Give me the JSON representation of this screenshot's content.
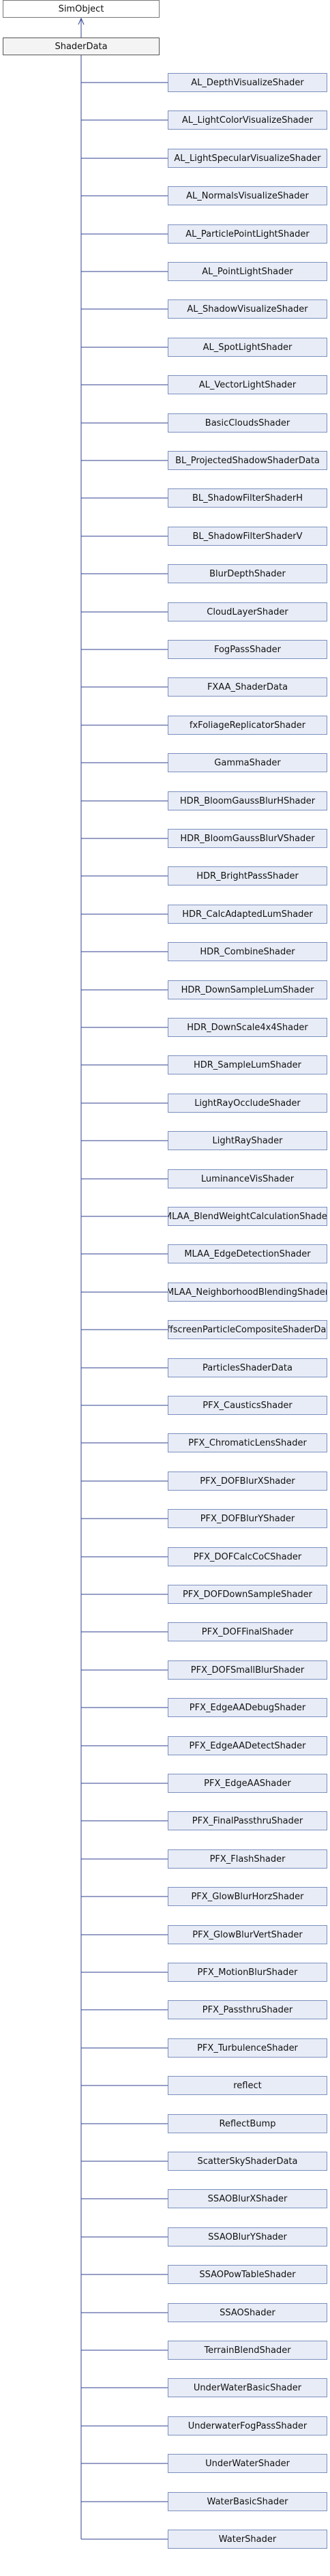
{
  "diagram": {
    "root": "SimObject",
    "parent": "ShaderData",
    "children": [
      "AL_DepthVisualizeShader",
      "AL_LightColorVisualizeShader",
      "AL_LightSpecularVisualizeShader",
      "AL_NormalsVisualizeShader",
      "AL_ParticlePointLightShader",
      "AL_PointLightShader",
      "AL_ShadowVisualizeShader",
      "AL_SpotLightShader",
      "AL_VectorLightShader",
      "BasicCloudsShader",
      "BL_ProjectedShadowShaderData",
      "BL_ShadowFilterShaderH",
      "BL_ShadowFilterShaderV",
      "BlurDepthShader",
      "CloudLayerShader",
      "FogPassShader",
      "FXAA_ShaderData",
      "fxFoliageReplicatorShader",
      "GammaShader",
      "HDR_BloomGaussBlurHShader",
      "HDR_BloomGaussBlurVShader",
      "HDR_BrightPassShader",
      "HDR_CalcAdaptedLumShader",
      "HDR_CombineShader",
      "HDR_DownSampleLumShader",
      "HDR_DownScale4x4Shader",
      "HDR_SampleLumShader",
      "LightRayOccludeShader",
      "LightRayShader",
      "LuminanceVisShader",
      "MLAA_BlendWeightCalculationShader",
      "MLAA_EdgeDetectionShader",
      "MLAA_NeighborhoodBlendingShader",
      "OffscreenParticleCompositeShaderData",
      "ParticlesShaderData",
      "PFX_CausticsShader",
      "PFX_ChromaticLensShader",
      "PFX_DOFBlurXShader",
      "PFX_DOFBlurYShader",
      "PFX_DOFCalcCoCShader",
      "PFX_DOFDownSampleShader",
      "PFX_DOFFinalShader",
      "PFX_DOFSmallBlurShader",
      "PFX_EdgeAADebugShader",
      "PFX_EdgeAADetectShader",
      "PFX_EdgeAAShader",
      "PFX_FinalPassthruShader",
      "PFX_FlashShader",
      "PFX_GlowBlurHorzShader",
      "PFX_GlowBlurVertShader",
      "PFX_MotionBlurShader",
      "PFX_PassthruShader",
      "PFX_TurbulenceShader",
      "reflect",
      "ReflectBump",
      "ScatterSkyShaderData",
      "SSAOBlurXShader",
      "SSAOBlurYShader",
      "SSAOPowTableShader",
      "SSAOShader",
      "TerrainBlendShader",
      "UnderWaterBasicShader",
      "UnderwaterFogPassShader",
      "UnderWaterShader",
      "WaterBasicShader",
      "WaterShader"
    ],
    "colors": {
      "child_fill": "#e8ecf6",
      "child_border": "#7a8fbf",
      "edge": "#2f3f8f",
      "text": "#111111"
    }
  }
}
